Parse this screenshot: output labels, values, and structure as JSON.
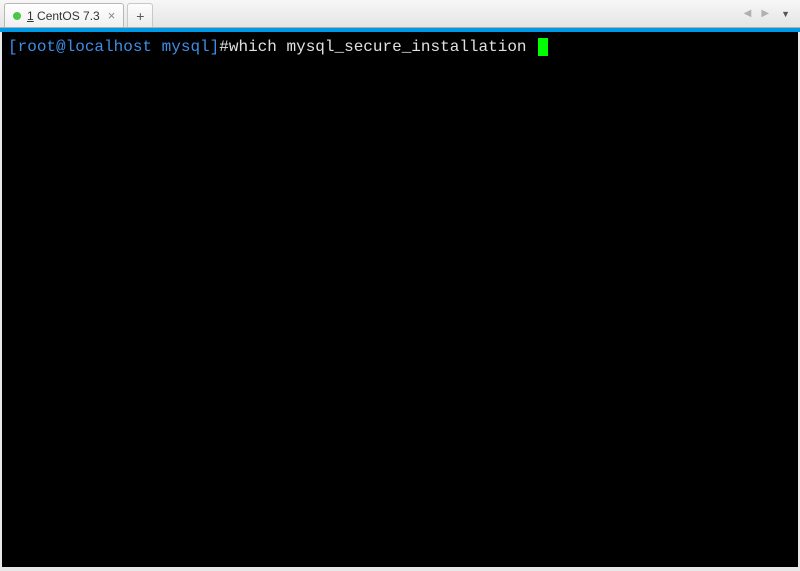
{
  "tabs": {
    "active": {
      "number": "1",
      "title": "CentOS 7.3"
    }
  },
  "terminal": {
    "prompt": {
      "open": "[",
      "userhost": "root@localhost",
      "space": " ",
      "path": "mysql",
      "close": "]",
      "symbol": "#"
    },
    "command": "which mysql_secure_installation"
  }
}
